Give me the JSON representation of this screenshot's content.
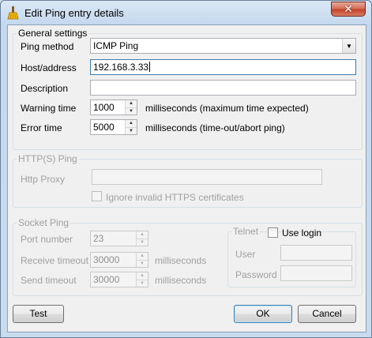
{
  "window": {
    "title": "Edit Ping entry details",
    "close_glyph": "✕",
    "title_icon": "broom-icon"
  },
  "general": {
    "legend": "General settings",
    "ping_method_label": "Ping method",
    "ping_method_value": "ICMP Ping",
    "ping_method_arrow": "▼",
    "host_label": "Host/address",
    "host_value": "192.168.3.33",
    "description_label": "Description",
    "description_value": "",
    "warning_label": "Warning time",
    "warning_value": "1000",
    "warning_unit": "milliseconds (maximum time expected)",
    "error_label": "Error time",
    "error_value": "5000",
    "error_unit": "milliseconds (time-out/abort ping)"
  },
  "http": {
    "legend": "HTTP(S) Ping",
    "proxy_label": "Http Proxy",
    "proxy_value": "",
    "ignore_https_label": "Ignore invalid HTTPS certificates"
  },
  "socket": {
    "legend": "Socket Ping",
    "port_label": "Port number",
    "port_value": "23",
    "receive_label": "Receive timeout",
    "receive_value": "30000",
    "receive_unit": "milliseconds",
    "send_label": "Send timeout",
    "send_value": "30000",
    "send_unit": "milliseconds"
  },
  "telnet": {
    "legend": "Telnet",
    "use_login_label": "Use login",
    "user_label": "User",
    "user_value": "",
    "password_label": "Password",
    "password_value": ""
  },
  "buttons": {
    "test": "Test",
    "ok": "OK",
    "cancel": "Cancel"
  },
  "spin_up": "▲",
  "spin_down": "▼"
}
